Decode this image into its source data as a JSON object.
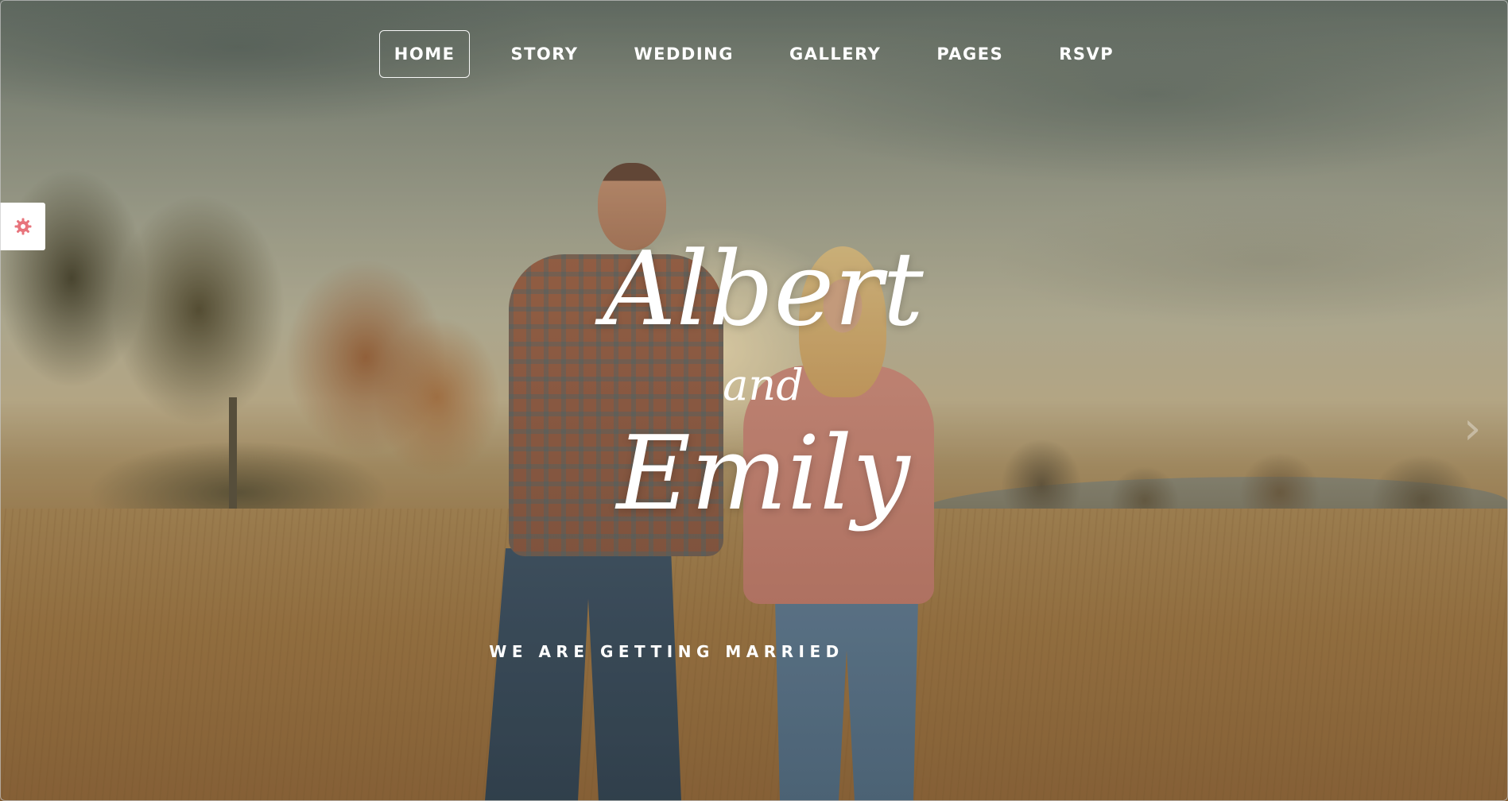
{
  "nav": {
    "items": [
      {
        "label": "HOME",
        "active": true
      },
      {
        "label": "STORY",
        "active": false
      },
      {
        "label": "WEDDING",
        "active": false
      },
      {
        "label": "GALLERY",
        "active": false
      },
      {
        "label": "PAGES",
        "active": false
      },
      {
        "label": "RSVP",
        "active": false
      }
    ]
  },
  "hero": {
    "first_name": "Albert",
    "connector": "and",
    "second_name": "Emily",
    "tagline": "WE ARE GETTING MARRIED",
    "next_arrow": "›"
  },
  "settings": {
    "icon": "gear-icon",
    "accent": "#e8747c"
  },
  "colors": {
    "text": "#ffffff",
    "accent": "#e8747c"
  }
}
